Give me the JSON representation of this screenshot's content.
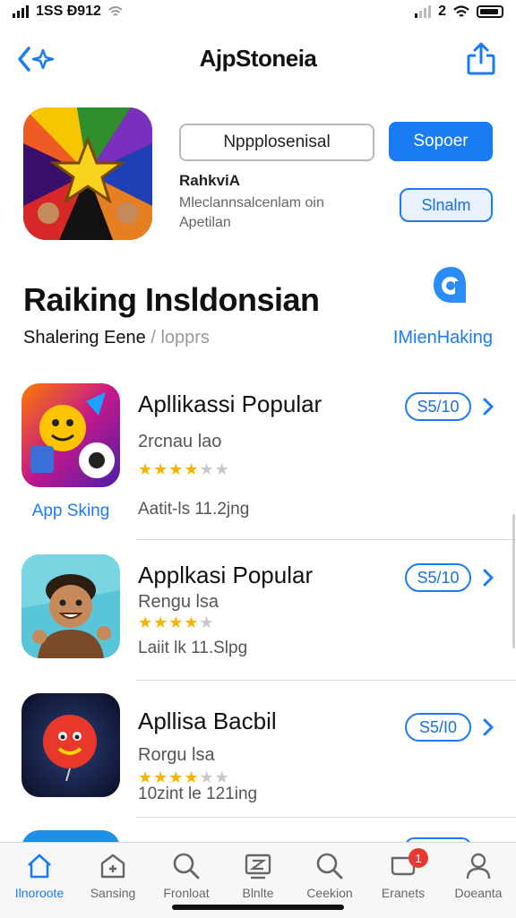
{
  "status_bar": {
    "time": "1SS Ð912",
    "right_text": "2"
  },
  "nav": {
    "title": "AjpStoneia"
  },
  "hero": {
    "primary_button": "Nppplosenisal",
    "secondary_button": "Sopoer",
    "developer": "RahkviA",
    "description_line1": "Mleclannsalcenlam oin",
    "description_line2": "Apetilan",
    "pill_button": "Slnalm"
  },
  "section": {
    "heading": "Raiking Insldonsian",
    "sub_main": "Shalering Eene",
    "sub_sep": " / ",
    "sub_muted": "lopprs",
    "link": "IMienHaking"
  },
  "apps": [
    {
      "name": "Apllikassi Popular",
      "category": "2rcnau lao",
      "rating": 3.5,
      "meta": "Aatit-ls 11.2jng",
      "price": "S5/10",
      "caption": "App Sking"
    },
    {
      "name": "Applkasi Popular",
      "category": "Rengu lsa",
      "rating": 4,
      "meta": "Laiit lk 11.Slpg",
      "price": "S5/10",
      "caption": ""
    },
    {
      "name": "Apllisa Bacbil",
      "category": "Rorgu lsa",
      "rating": 3.5,
      "meta": "10zint le 121ing",
      "price": "S5/I0",
      "caption": ""
    }
  ],
  "tabbar": {
    "tabs": [
      {
        "label": "Ilnoroote",
        "icon": "home-icon"
      },
      {
        "label": "Sansing",
        "icon": "store-icon"
      },
      {
        "label": "Fronloat",
        "icon": "search-icon"
      },
      {
        "label": "Blnlte",
        "icon": "chart-icon"
      },
      {
        "label": "Ceekion",
        "icon": "search-icon"
      },
      {
        "label": "Eranets",
        "icon": "updates-icon",
        "badge": "1"
      },
      {
        "label": "Doeanta",
        "icon": "account-icon"
      }
    ]
  },
  "colors": {
    "accent": "#1a7cf5",
    "star": "#f5b400",
    "badge": "#e53935"
  }
}
